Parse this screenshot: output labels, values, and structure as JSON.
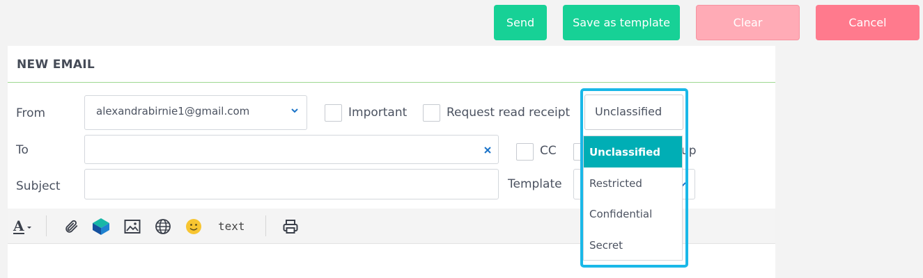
{
  "actions": {
    "send": "Send",
    "save_template": "Save as template",
    "clear": "Clear",
    "cancel": "Cancel"
  },
  "panel": {
    "title": "NEW EMAIL"
  },
  "form": {
    "from_label": "From",
    "from_value": "alexandrabirnie1@gmail.com",
    "to_label": "To",
    "to_value": "",
    "subject_label": "Subject",
    "subject_value": "",
    "template_label": "Template"
  },
  "options": {
    "important": "Important",
    "read_receipt": "Request read receipt",
    "cc": "CC",
    "group_partial": "up"
  },
  "classification": {
    "selected": "Unclassified",
    "items": [
      "Unclassified",
      "Restricted",
      "Confidential",
      "Secret"
    ]
  },
  "toolbar": {
    "text_button": "text"
  },
  "colors": {
    "primary": "#17d196",
    "danger": "#ff7a8d",
    "danger_light": "#ffabb6",
    "selection": "#00aeb5",
    "highlight": "#1ab8e8",
    "rule": "#9cd88f"
  },
  "icons": [
    "font-color-icon",
    "paperclip-icon",
    "logo-icon",
    "image-icon",
    "globe-icon",
    "emoji-icon",
    "print-icon",
    "chevron-down-icon",
    "clear-x-icon"
  ]
}
